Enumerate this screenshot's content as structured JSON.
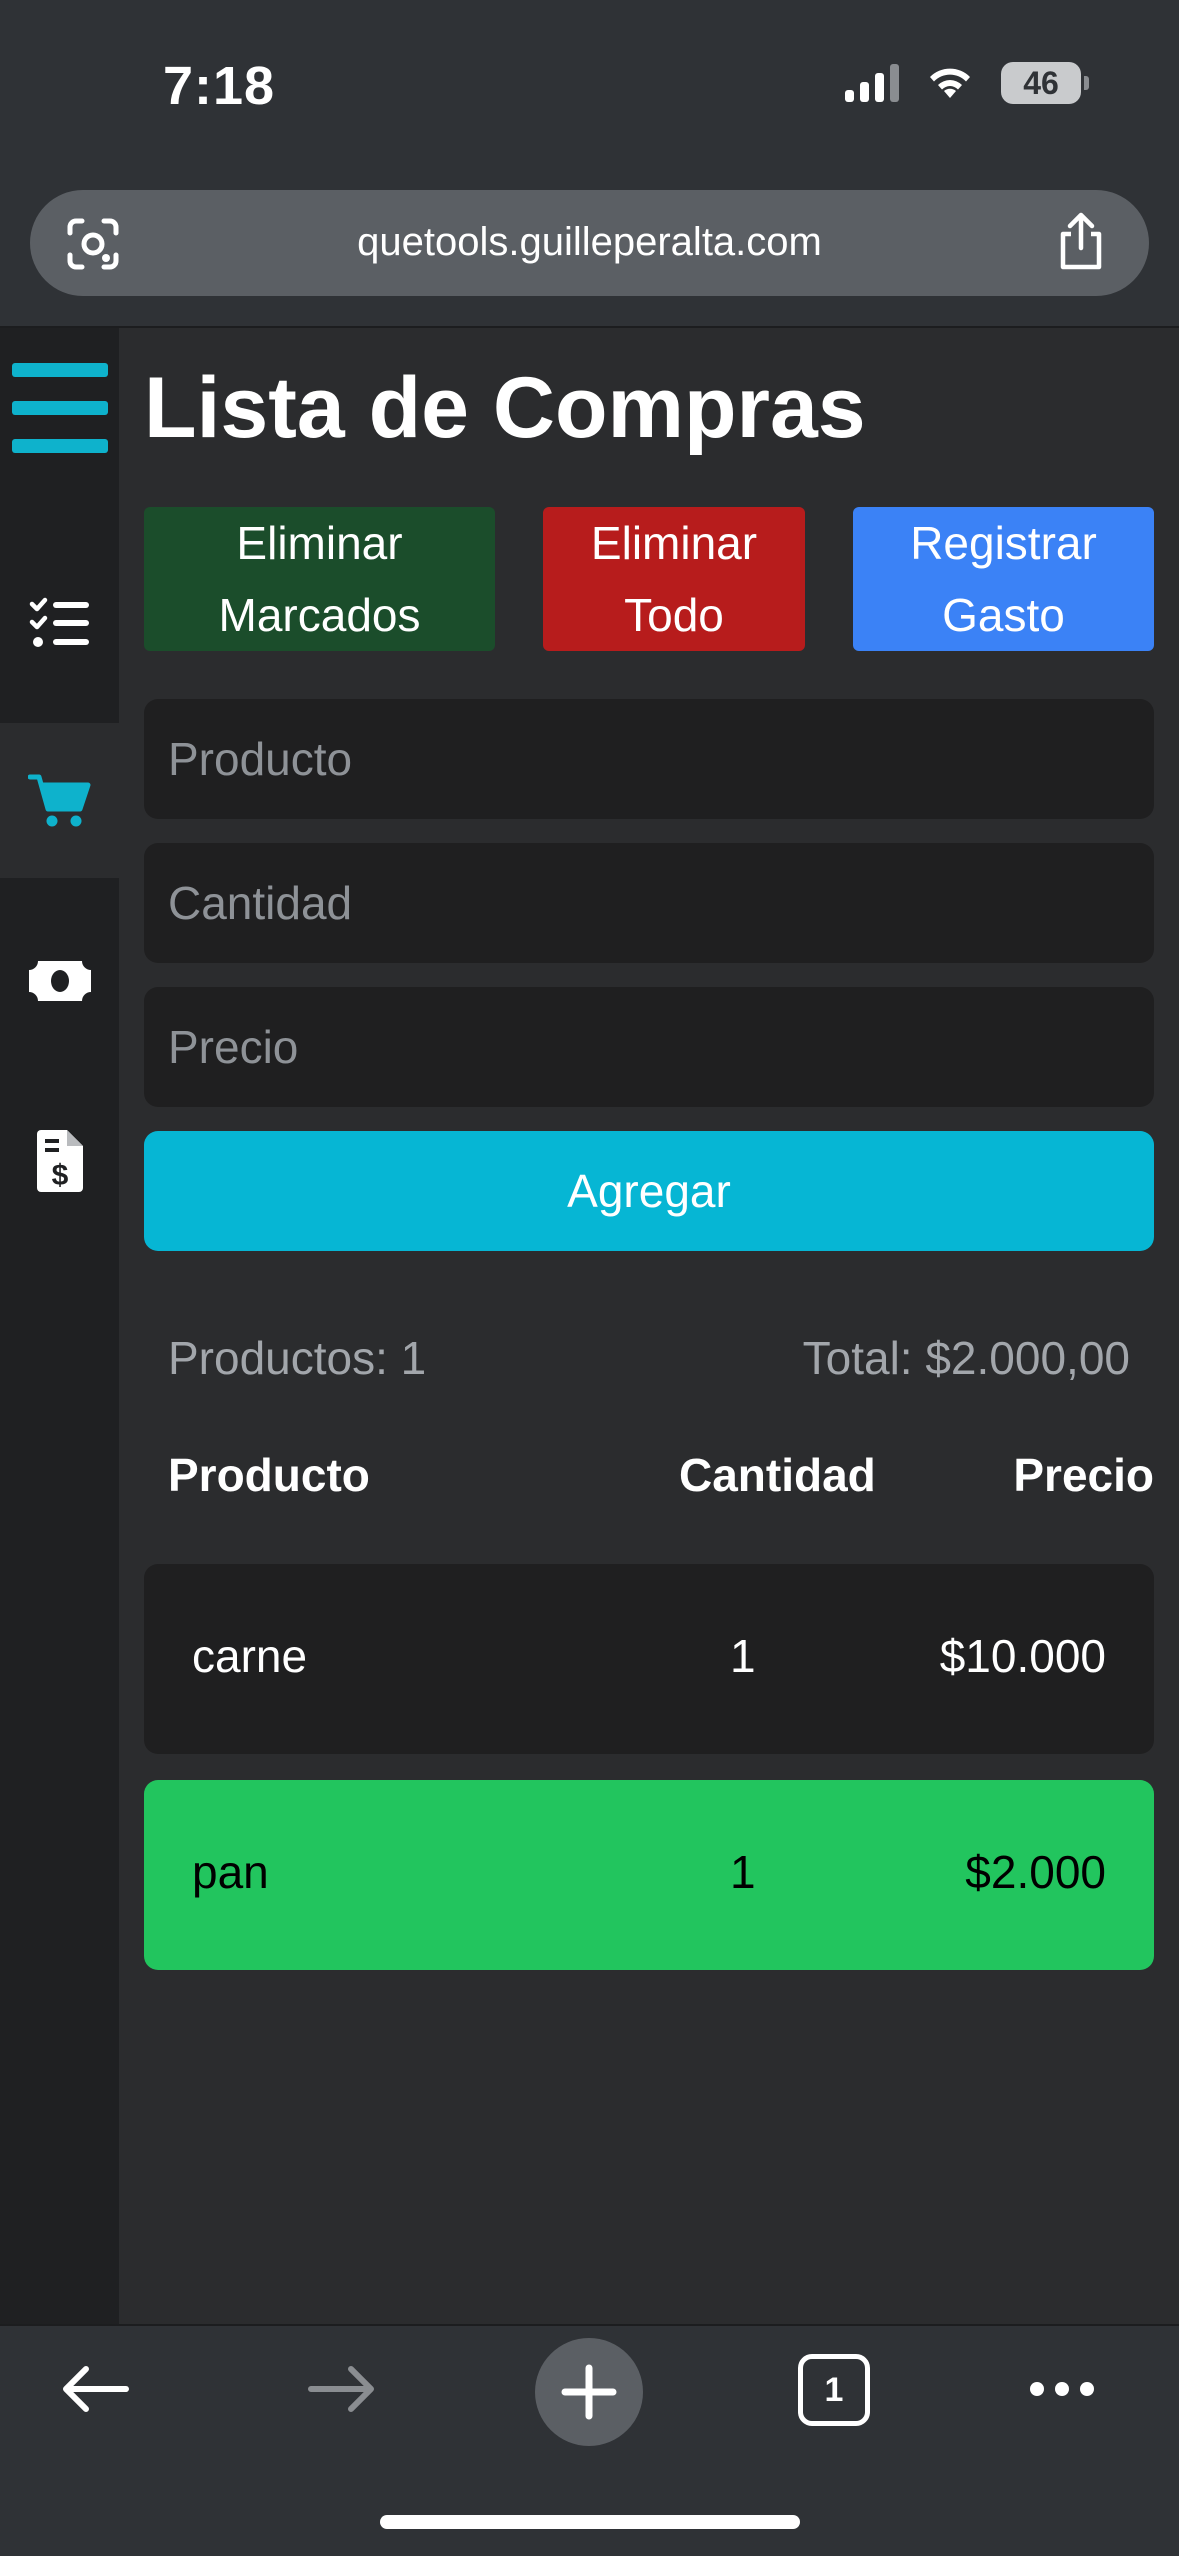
{
  "status": {
    "time": "7:18",
    "battery": "46"
  },
  "browser": {
    "url": "quetools.guilleperalta.com",
    "tab_count": "1"
  },
  "sidebar": {
    "menu_icon": "hamburger-icon",
    "items": [
      {
        "icon": "checklist-icon",
        "active": false
      },
      {
        "icon": "cart-icon",
        "active": true
      },
      {
        "icon": "money-icon",
        "active": false
      },
      {
        "icon": "invoice-icon",
        "active": false
      }
    ],
    "colors": {
      "accent": "#0eb2cc"
    }
  },
  "page": {
    "title": "Lista de Compras",
    "buttons": {
      "delete_marked_line1": "Eliminar",
      "delete_marked_line2": "Marcados",
      "delete_all_line1": "Eliminar",
      "delete_all_line2": "Todo",
      "register_line1": "Registrar",
      "register_line2": "Gasto"
    },
    "form": {
      "product_placeholder": "Producto",
      "quantity_placeholder": "Cantidad",
      "price_placeholder": "Precio",
      "product_value": "",
      "quantity_value": "",
      "price_value": "",
      "add_label": "Agregar"
    },
    "summary": {
      "products": "Productos: 1",
      "total": "Total: $2.000,00"
    },
    "table": {
      "headers": {
        "product": "Producto",
        "quantity": "Cantidad",
        "price": "Precio"
      },
      "rows": [
        {
          "product": "carne",
          "quantity": "1",
          "price": "$10.000",
          "marked": false
        },
        {
          "product": "pan",
          "quantity": "1",
          "price": "$2.000",
          "marked": true
        }
      ]
    },
    "colors": {
      "delete_marked": "#1b4d2b",
      "delete_all": "#b71c1c",
      "register": "#3b82f6",
      "add": "#06b6d4",
      "marked_row": "#22c55e"
    }
  }
}
